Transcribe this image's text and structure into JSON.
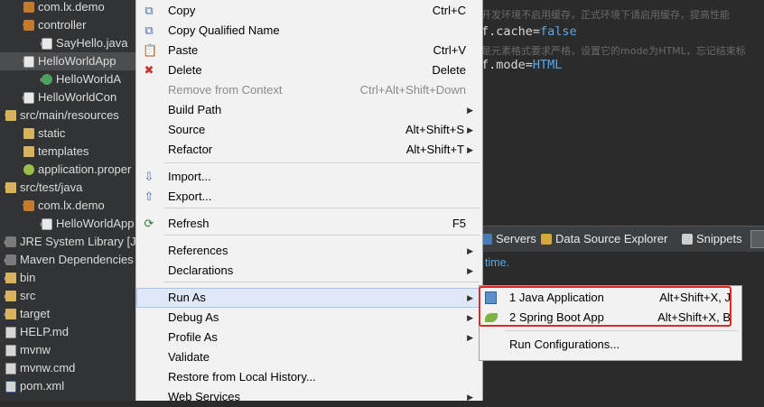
{
  "project_tree": {
    "items": [
      {
        "label": "com.lx.demo",
        "icon": "package-icon",
        "indent": 40,
        "twisty": "",
        "sel": false
      },
      {
        "label": "controller",
        "icon": "package-icon",
        "indent": 40,
        "twisty": "▾",
        "sel": false
      },
      {
        "label": "SayHello.java",
        "icon": "java-file-icon",
        "indent": 60,
        "twisty": "▸",
        "sel": false
      },
      {
        "label": "HelloWorldApp",
        "icon": "java-file-icon",
        "indent": 40,
        "twisty": "▾",
        "sel": true
      },
      {
        "label": "HelloWorldA",
        "icon": "spring-class-icon",
        "indent": 60,
        "twisty": "▸",
        "sel": false
      },
      {
        "label": "HelloWorldCon",
        "icon": "java-file-icon",
        "indent": 40,
        "twisty": "▸",
        "sel": false
      },
      {
        "label": "src/main/resources",
        "icon": "source-folder-icon",
        "indent": 20,
        "twisty": "▾",
        "sel": false
      },
      {
        "label": "static",
        "icon": "folder-icon",
        "indent": 40,
        "twisty": "",
        "sel": false
      },
      {
        "label": "templates",
        "icon": "folder-icon",
        "indent": 40,
        "twisty": "",
        "sel": false
      },
      {
        "label": "application.proper",
        "icon": "properties-icon",
        "indent": 40,
        "twisty": "",
        "sel": false
      },
      {
        "label": "src/test/java",
        "icon": "source-folder-icon",
        "indent": 20,
        "twisty": "▾",
        "sel": false
      },
      {
        "label": "com.lx.demo",
        "icon": "package-icon",
        "indent": 40,
        "twisty": "▾",
        "sel": false
      },
      {
        "label": "HelloWorldApp",
        "icon": "java-file-icon",
        "indent": 60,
        "twisty": "▸",
        "sel": false
      },
      {
        "label": "JRE System Library [Ja",
        "icon": "library-icon",
        "indent": 20,
        "twisty": "▸",
        "sel": false
      },
      {
        "label": "Maven Dependencies",
        "icon": "library-icon",
        "indent": 20,
        "twisty": "▸",
        "sel": false
      },
      {
        "label": "bin",
        "icon": "folder-icon",
        "indent": 20,
        "twisty": "▸",
        "sel": false
      },
      {
        "label": "src",
        "icon": "folder-icon",
        "indent": 20,
        "twisty": "▸",
        "sel": false
      },
      {
        "label": "target",
        "icon": "folder-icon",
        "indent": 20,
        "twisty": "▸",
        "sel": false
      },
      {
        "label": "HELP.md",
        "icon": "file-icon",
        "indent": 20,
        "twisty": "",
        "sel": false
      },
      {
        "label": "mvnw",
        "icon": "file-icon",
        "indent": 20,
        "twisty": "",
        "sel": false
      },
      {
        "label": "mvnw.cmd",
        "icon": "file-icon",
        "indent": 20,
        "twisty": "",
        "sel": false
      },
      {
        "label": "pom.xml",
        "icon": "xml-file-icon",
        "indent": 20,
        "twisty": "",
        "sel": false
      }
    ]
  },
  "editor": {
    "line1_comment": "开发环境不启用缓存，正式环境下请启用缓存，提高性能",
    "line2_key": "f.cache=",
    "line2_val": "false",
    "line3_comment": "是元素格式要求严格，设置它的mode为HTML，忘记结束标",
    "line4_key": "f.mode=",
    "line4_val": "HTML"
  },
  "bottom_tabs": {
    "servers": "Servers",
    "datasource": "Data Source Explorer",
    "snippets": "Snippets"
  },
  "console": {
    "text": "time."
  },
  "context_menu": {
    "items": [
      {
        "label": "Copy",
        "shortcut": "Ctrl+C",
        "icon": "copy-icon",
        "glyph": "⧉",
        "disabled": false,
        "submenu": false
      },
      {
        "label": "Copy Qualified Name",
        "shortcut": "",
        "icon": "copy-qualified-icon",
        "glyph": "⧉",
        "disabled": false,
        "submenu": false
      },
      {
        "label": "Paste",
        "shortcut": "Ctrl+V",
        "icon": "paste-icon",
        "glyph": "📋",
        "disabled": false,
        "submenu": false
      },
      {
        "label": "Delete",
        "shortcut": "Delete",
        "icon": "delete-icon",
        "glyph": "✖",
        "disabled": false,
        "submenu": false
      },
      {
        "label": "Remove from Context",
        "shortcut": "Ctrl+Alt+Shift+Down",
        "icon": "remove-context-icon",
        "glyph": "",
        "disabled": true,
        "submenu": false
      },
      {
        "label": "Build Path",
        "shortcut": "",
        "icon": "",
        "glyph": "",
        "disabled": false,
        "submenu": true
      },
      {
        "label": "Source",
        "shortcut": "Alt+Shift+S",
        "icon": "",
        "glyph": "",
        "disabled": false,
        "submenu": true
      },
      {
        "label": "Refactor",
        "shortcut": "Alt+Shift+T",
        "icon": "",
        "glyph": "",
        "disabled": false,
        "submenu": true
      },
      {
        "label": "Import...",
        "shortcut": "",
        "icon": "import-icon",
        "glyph": "⇩",
        "disabled": false,
        "submenu": false
      },
      {
        "label": "Export...",
        "shortcut": "",
        "icon": "export-icon",
        "glyph": "⇧",
        "disabled": false,
        "submenu": false
      },
      {
        "label": "Refresh",
        "shortcut": "F5",
        "icon": "refresh-icon",
        "glyph": "⟳",
        "disabled": false,
        "submenu": false
      },
      {
        "label": "References",
        "shortcut": "",
        "icon": "",
        "glyph": "",
        "disabled": false,
        "submenu": true
      },
      {
        "label": "Declarations",
        "shortcut": "",
        "icon": "",
        "glyph": "",
        "disabled": false,
        "submenu": true
      },
      {
        "label": "Run As",
        "shortcut": "",
        "icon": "",
        "glyph": "",
        "disabled": false,
        "submenu": true,
        "highlight": true
      },
      {
        "label": "Debug As",
        "shortcut": "",
        "icon": "",
        "glyph": "",
        "disabled": false,
        "submenu": true
      },
      {
        "label": "Profile As",
        "shortcut": "",
        "icon": "",
        "glyph": "",
        "disabled": false,
        "submenu": true
      },
      {
        "label": "Validate",
        "shortcut": "",
        "icon": "",
        "glyph": "",
        "disabled": false,
        "submenu": false
      },
      {
        "label": "Restore from Local History...",
        "shortcut": "",
        "icon": "",
        "glyph": "",
        "disabled": false,
        "submenu": false
      },
      {
        "label": "Web Services",
        "shortcut": "",
        "icon": "",
        "glyph": "",
        "disabled": false,
        "submenu": true
      }
    ]
  },
  "run_as_submenu": {
    "items": [
      {
        "label": "1 Java Application",
        "shortcut": "Alt+Shift+X, J",
        "icon": "java-app-icon"
      },
      {
        "label": "2 Spring Boot App",
        "shortcut": "Alt+Shift+X, B",
        "icon": "spring-boot-icon"
      },
      {
        "label": "Run Configurations...",
        "shortcut": "",
        "icon": ""
      }
    ]
  },
  "colors": {
    "highlight_box": "#e0281e",
    "menu_bg": "#f2f2f2",
    "tree_bg": "#313335"
  }
}
